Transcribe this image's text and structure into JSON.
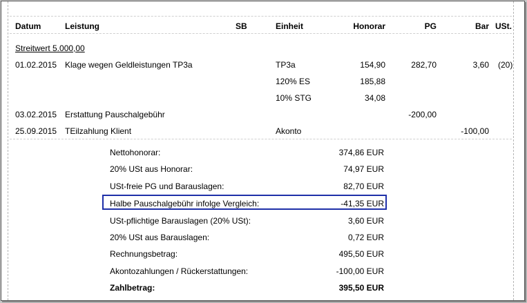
{
  "header": {
    "datum": "Datum",
    "leistung": "Leistung",
    "sb": "SB",
    "einheit": "Einheit",
    "honorar": "Honorar",
    "pg": "PG",
    "bar": "Bar",
    "ust": "USt."
  },
  "streitwert": "Streitwert 5.000,00",
  "rows": [
    {
      "datum": "01.02.2015",
      "leistung": "Klage wegen Geldleistungen TP3a",
      "einheit": "TP3a",
      "honorar": "154,90",
      "pg": "282,70",
      "bar": "3,60",
      "ust": "(20)"
    },
    {
      "datum": "",
      "leistung": "",
      "einheit": "120% ES",
      "honorar": "185,88",
      "pg": "",
      "bar": "",
      "ust": ""
    },
    {
      "datum": "",
      "leistung": "",
      "einheit": "10% STG",
      "honorar": "34,08",
      "pg": "",
      "bar": "",
      "ust": ""
    },
    {
      "datum": "03.02.2015",
      "leistung": "Erstattung Pauschalgebühr",
      "einheit": "",
      "honorar": "",
      "pg": "-200,00",
      "bar": "",
      "ust": ""
    },
    {
      "datum": "25.09.2015",
      "leistung": "TEilzahlung Klient",
      "einheit": "Akonto",
      "honorar": "",
      "pg": "",
      "bar": "-100,00",
      "ust": ""
    }
  ],
  "summary": [
    {
      "label": "Nettohonorar:",
      "value": "374,86 EUR"
    },
    {
      "label": "20% USt aus Honorar:",
      "value": "74,97 EUR"
    },
    {
      "label": "USt-freie PG und Barauslagen:",
      "value": "82,70 EUR"
    },
    {
      "label": "Halbe Pauschalgebühr infolge Vergleich:",
      "value": "-41,35 EUR"
    },
    {
      "label": "USt-pflichtige Barauslagen (20% USt):",
      "value": "3,60 EUR"
    },
    {
      "label": "20% USt aus Barauslagen:",
      "value": "0,72 EUR"
    },
    {
      "label": "Rechnungsbetrag:",
      "value": "495,50 EUR"
    },
    {
      "label": "Akontozahlungen / Rückerstattungen:",
      "value": "-100,00 EUR"
    },
    {
      "label": "Zahlbetrag:",
      "value": "395,50 EUR"
    }
  ]
}
